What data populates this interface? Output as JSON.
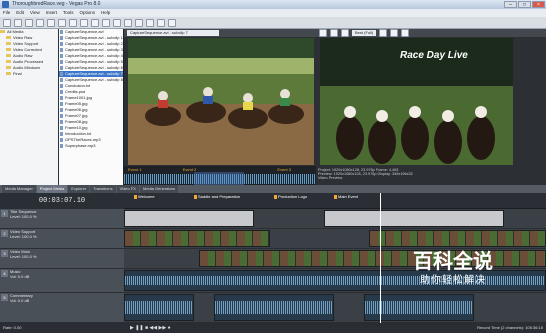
{
  "window": {
    "title": "ThoroughbredRace.veg - Vegas Pro 8.0"
  },
  "menu": [
    "File",
    "Edit",
    "View",
    "Insert",
    "Tools",
    "Options",
    "Help"
  ],
  "explorer": {
    "tree": [
      "All Media",
      "Video Raw",
      "Video Support",
      "Video Corrected",
      "Audio Raw",
      "Audio Processed",
      "Audio Mixdown",
      "Final"
    ],
    "files": [
      "CaptureSequence.avi",
      "CaptureSequence.avi - subclip 1",
      "CaptureSequence.avi - subclip 2",
      "CaptureSequence.avi - subclip 3",
      "CaptureSequence.avi - subclip 4",
      "CaptureSequence.avi - subclip 5",
      "CaptureSequence.avi - subclip 6",
      "CaptureSequence.avi - subclip 7",
      "CaptureSequence.avi - subclip 8",
      "Conclusion.txt",
      "Credits.psd",
      "Frame1001.jpg",
      "Frame05.jpg",
      "Frame06.jpg",
      "Frame07.jpg",
      "Frame08.jpg",
      "Frame10.jpg",
      "Introduction.txt",
      "GPSTheRaces.mp3",
      "Superphase.mp3"
    ]
  },
  "trimmer": {
    "clip": "CaptureSequence.avi - subclip 7",
    "markers": [
      "Event 1",
      "Event 2",
      "Event 3"
    ],
    "info": "Video: 1920x1080x24, 23.976 fps, 00:00:12;24\nAudio: 48,000 Hz, 16 Bit, Stereo, 00:00:12;29"
  },
  "preview": {
    "quality": "Best (Full)",
    "overlay_text": "Race Day Live",
    "info": "Project: 1920x1080x128, 23.976p   Frame: 4,463\nPreview: 1920x1080x128, 23.976p   Display: 349x196x32\nVideo Preview"
  },
  "tabs": [
    "Media Manager",
    "Project Media",
    "Explorer",
    "Transitions",
    "Video FX",
    "Media Generators"
  ],
  "timeline": {
    "current_time": "00:03:07.10",
    "markers": [
      "Welcome",
      "Saddle and Preparation",
      "Production Logo",
      "Main Event"
    ],
    "tracks": [
      {
        "num": "1",
        "name": "Title Sequence",
        "level": "Level: 100.0 %"
      },
      {
        "num": "2",
        "name": "Video Support",
        "level": "Level: 100.0 %"
      },
      {
        "num": "3",
        "name": "Video Main",
        "level": "Level: 100.0 %"
      },
      {
        "num": "4",
        "name": "Music",
        "level": "Vol: 0.0 dB"
      },
      {
        "num": "5",
        "name": "Commentary",
        "level": "Vol: 0.0 dB"
      }
    ],
    "rate": "Rate: 0.00",
    "record_time": "Record Time (2 channels): 105:36:15"
  },
  "watermark": {
    "title": "百科全说",
    "subtitle": "助你轻松解决"
  }
}
